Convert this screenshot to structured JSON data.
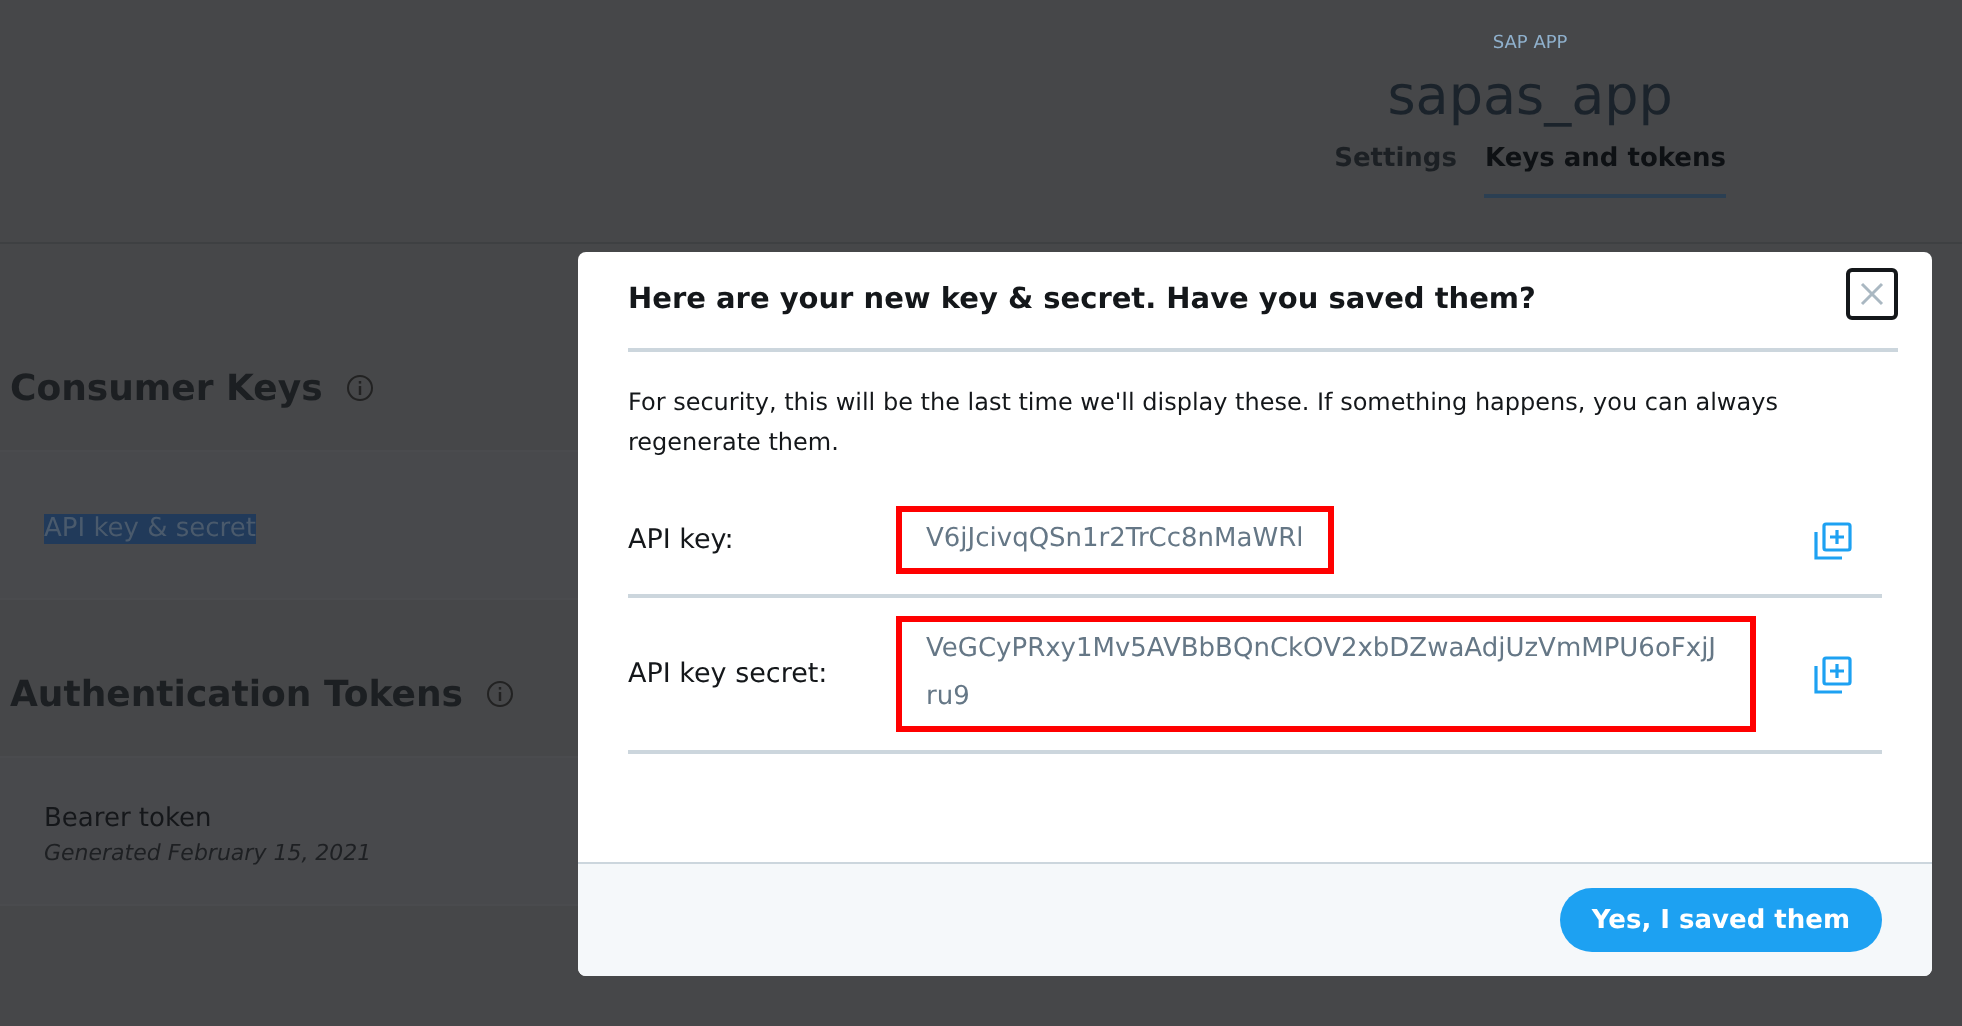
{
  "app": {
    "label": "SAP APP",
    "name": "sapas_app"
  },
  "tabs": [
    {
      "label": "Settings",
      "selected": false
    },
    {
      "label": "Keys and tokens",
      "selected": true
    }
  ],
  "sections": [
    {
      "title": "Consumer Keys",
      "items": [
        {
          "label": "API key & secret",
          "text_selected": true
        }
      ]
    },
    {
      "title": "Authentication Tokens",
      "items": [
        {
          "label": "Bearer token",
          "text_selected": false,
          "sub": "Generated February 15, 2021"
        }
      ]
    }
  ],
  "dialog": {
    "title": "Here are your new key & secret. Have you saved them?",
    "message": "For security, this will be the last time we'll display these. If something happens, you can always regenerate them.",
    "keys": [
      {
        "label": "API key:",
        "value": "V6jJcivqQSn1r2TrCc8nMaWRl",
        "outlined": true
      },
      {
        "label": "API key secret:",
        "value": "VeGCyPRxy1Mv5AVBbBQnCkOV2xbDZwaAdjUzVmMPU6oFxjJru9",
        "outlined": true
      }
    ],
    "confirm": "Yes, I saved them"
  }
}
